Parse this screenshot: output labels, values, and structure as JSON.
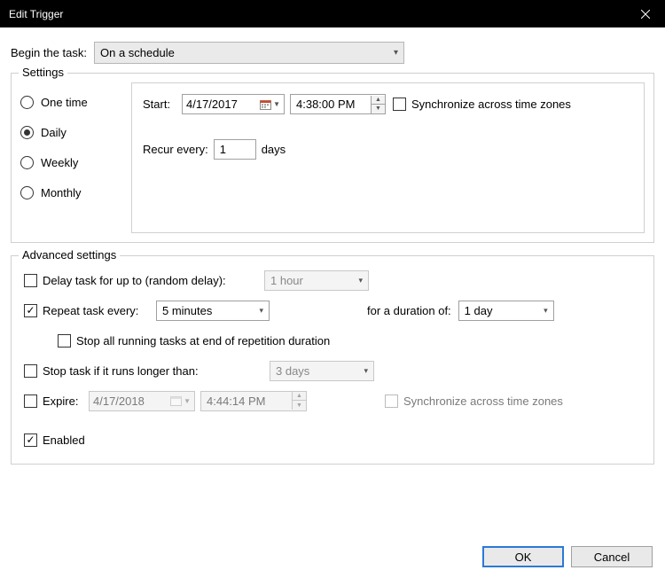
{
  "title": "Edit Trigger",
  "begin_label": "Begin the task:",
  "begin_value": "On a schedule",
  "fieldset_label": "Settings",
  "radios": {
    "one_time": "One time",
    "daily": "Daily",
    "weekly": "Weekly",
    "monthly": "Monthly"
  },
  "start_label": "Start:",
  "start_date": "4/17/2017",
  "start_time": "4:38:00 PM",
  "sync_label": "Synchronize across time zones",
  "recur_label": "Recur every:",
  "recur_value": "1",
  "recur_unit": "days",
  "adv": {
    "title": "Advanced settings",
    "delay_label": "Delay task for up to (random delay):",
    "delay_value": "1 hour",
    "repeat_label": "Repeat task every:",
    "repeat_value": "5 minutes",
    "duration_label": "for a duration of:",
    "duration_value": "1 day",
    "stop_all_label": "Stop all running tasks at end of repetition duration",
    "stop_long_label": "Stop task if it runs longer than:",
    "stop_long_value": "3 days",
    "expire_label": "Expire:",
    "expire_date": "4/17/2018",
    "expire_time": "4:44:14 PM",
    "expire_sync": "Synchronize across time zones",
    "enabled_label": "Enabled"
  },
  "buttons": {
    "ok": "OK",
    "cancel": "Cancel"
  }
}
